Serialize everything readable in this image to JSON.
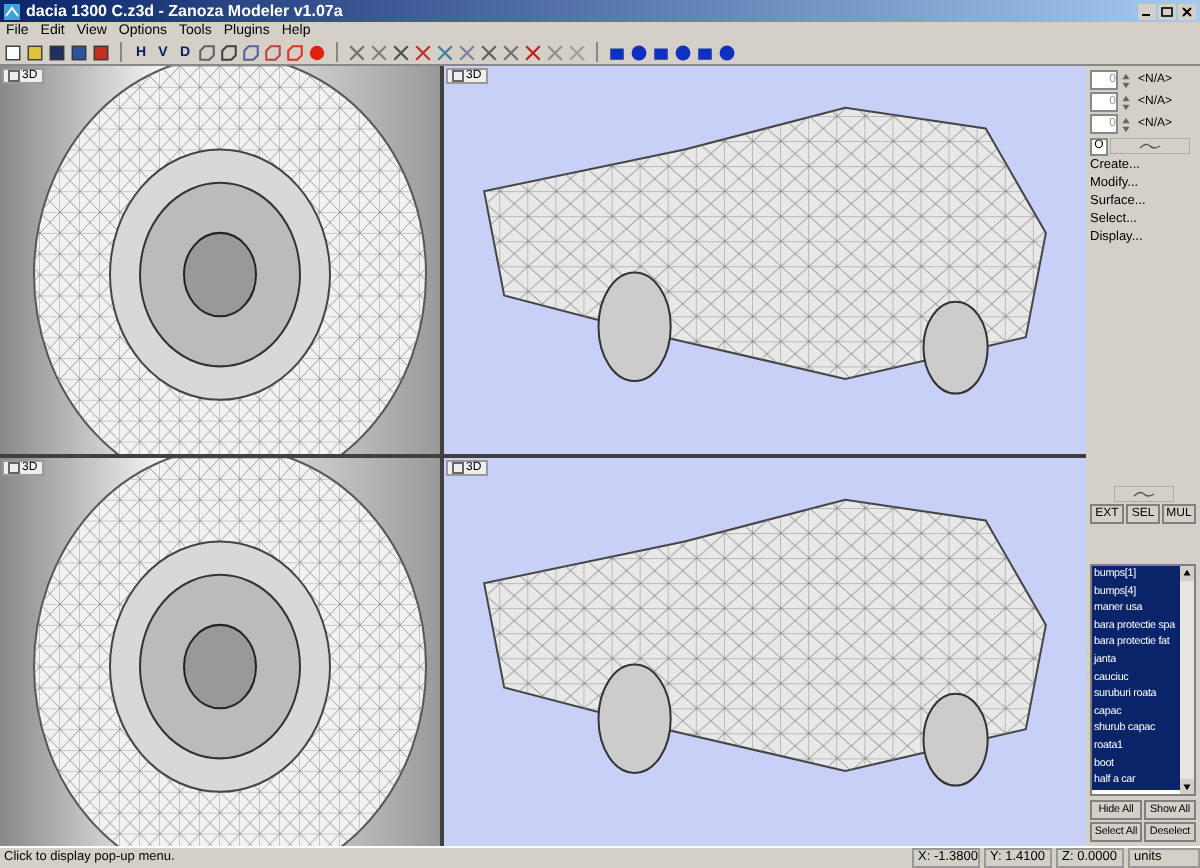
{
  "window": {
    "title": "dacia 1300 C.z3d - Zanoza Modeler v1.07a"
  },
  "menu": [
    "File",
    "Edit",
    "View",
    "Options",
    "Tools",
    "Plugins",
    "Help"
  ],
  "toolbar_letters": [
    "H",
    "V",
    "D"
  ],
  "viewports": [
    {
      "label": "3D",
      "kind": "wheel"
    },
    {
      "label": "3D",
      "kind": "car"
    },
    {
      "label": "3D",
      "kind": "wheel"
    },
    {
      "label": "3D",
      "kind": "car"
    }
  ],
  "panel": {
    "spinners": [
      {
        "value": "0",
        "label": "<N/A>"
      },
      {
        "value": "0",
        "label": "<N/A>"
      },
      {
        "value": "0",
        "label": "<N/A>"
      }
    ],
    "check_label": "O",
    "commands": [
      "Create...",
      "Modify...",
      "Surface...",
      "Select...",
      "Display..."
    ],
    "modes": [
      "EXT",
      "SEL",
      "MUL"
    ],
    "objects": [
      {
        "name": "bumps[1]",
        "selected": true
      },
      {
        "name": "bumps[4]",
        "selected": true
      },
      {
        "name": "maner usa",
        "selected": true
      },
      {
        "name": "bara protectie spa",
        "selected": true
      },
      {
        "name": "bara protectie fat",
        "selected": true
      },
      {
        "name": "janta",
        "selected": true
      },
      {
        "name": "cauciuc",
        "selected": true
      },
      {
        "name": "suruburi roata",
        "selected": true
      },
      {
        "name": "capac",
        "selected": true
      },
      {
        "name": "shurub capac",
        "selected": true
      },
      {
        "name": "roata1",
        "selected": true
      },
      {
        "name": "boot",
        "selected": true
      },
      {
        "name": "half a car",
        "selected": true
      }
    ],
    "list_buttons": [
      "Hide All",
      "Show All",
      "Select All",
      "Deselect"
    ]
  },
  "status_bar": {
    "message": "Click to display pop-up menu.",
    "x": "X: -1.3800",
    "y": "Y: 1.4100",
    "z": "Z: 0.0000",
    "units": "units"
  }
}
